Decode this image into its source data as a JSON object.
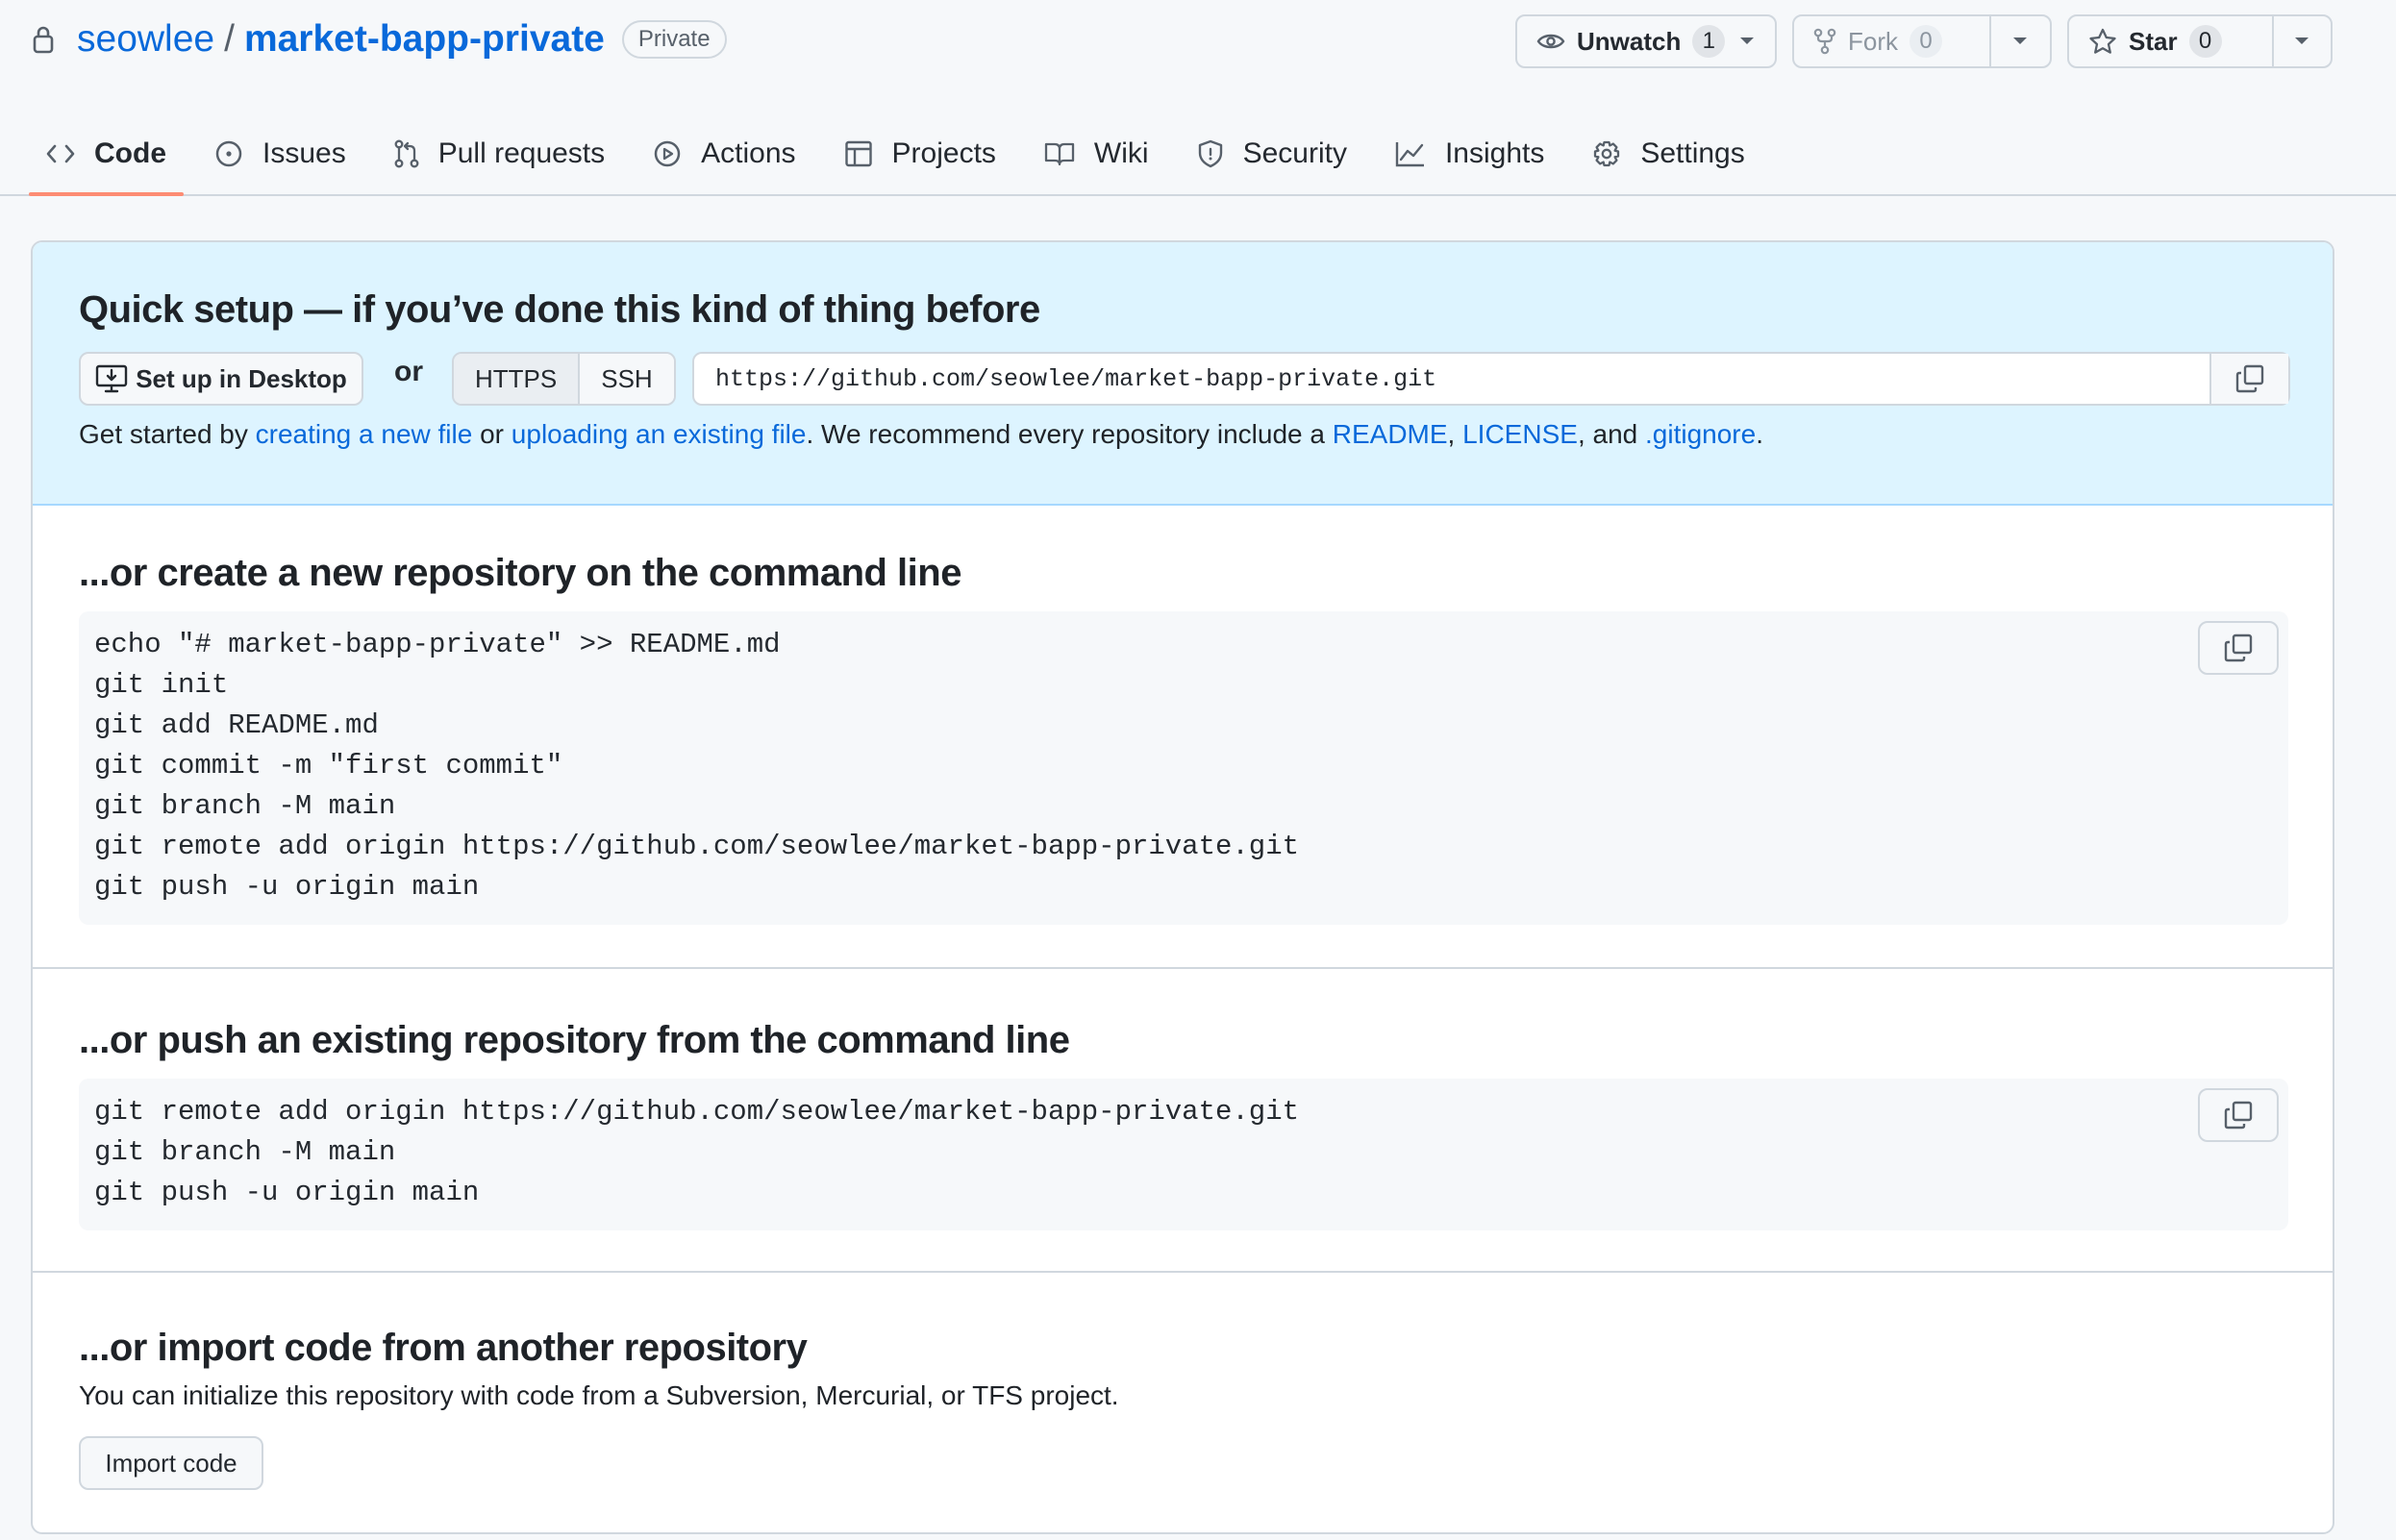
{
  "header": {
    "owner": "seowlee",
    "separator": "/",
    "repo": "market-bapp-private",
    "visibility": "Private",
    "watch": {
      "label": "Unwatch",
      "count": "1"
    },
    "fork": {
      "label": "Fork",
      "count": "0"
    },
    "star": {
      "label": "Star",
      "count": "0"
    }
  },
  "tabs": [
    {
      "label": "Code",
      "icon": "code-icon",
      "active": true
    },
    {
      "label": "Issues",
      "icon": "issue-icon"
    },
    {
      "label": "Pull requests",
      "icon": "pull-request-icon"
    },
    {
      "label": "Actions",
      "icon": "play-icon"
    },
    {
      "label": "Projects",
      "icon": "table-icon"
    },
    {
      "label": "Wiki",
      "icon": "book-icon"
    },
    {
      "label": "Security",
      "icon": "shield-icon"
    },
    {
      "label": "Insights",
      "icon": "graph-icon"
    },
    {
      "label": "Settings",
      "icon": "gear-icon"
    }
  ],
  "quick_setup": {
    "title": "Quick setup — if you’ve done this kind of thing before",
    "desktop_label": "Set up in Desktop",
    "or": "or",
    "https": "HTTPS",
    "ssh": "SSH",
    "url": "https://github.com/seowlee/market-bapp-private.git",
    "help": {
      "prefix": "Get started by ",
      "link1": "creating a new file",
      "mid1": " or ",
      "link2": "uploading an existing file",
      "mid2": ". We recommend every repository include a ",
      "link3": "README",
      "c1": ", ",
      "link4": "LICENSE",
      "c2": ", and ",
      "link5": ".gitignore",
      "end": "."
    }
  },
  "new_repo": {
    "title": "...or create a new repository on the command line",
    "lines": [
      "echo \"# market-bapp-private\" >> README.md",
      "git init",
      "git add README.md",
      "git commit -m \"first commit\"",
      "git branch -M main",
      "git remote add origin https://github.com/seowlee/market-bapp-private.git",
      "git push -u origin main"
    ]
  },
  "push_existing": {
    "title": "...or push an existing repository from the command line",
    "lines": [
      "git remote add origin https://github.com/seowlee/market-bapp-private.git",
      "git branch -M main",
      "git push -u origin main"
    ]
  },
  "import": {
    "title": "...or import code from another repository",
    "description": "You can initialize this repository with code from a Subversion, Mercurial, or TFS project.",
    "button": "Import code"
  },
  "colors": {
    "link": "#0969da",
    "active_tab_underline": "#fd8c73",
    "quick_setup_bg": "#ddf4ff"
  }
}
